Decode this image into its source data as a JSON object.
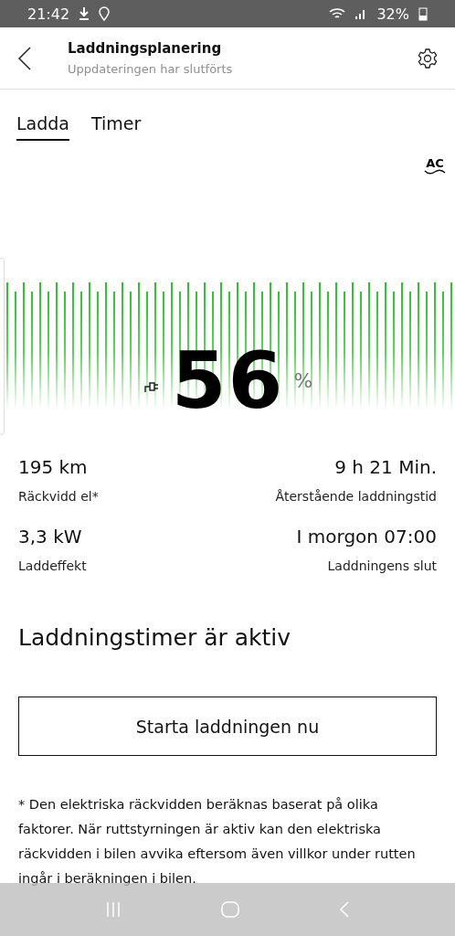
{
  "status_bar": {
    "time": "21:42",
    "battery": "32%"
  },
  "header": {
    "title": "Laddningsplanering",
    "subtitle": "Uppdateringen har slutförts"
  },
  "tabs": [
    {
      "label": "Ladda",
      "selected": true
    },
    {
      "label": "Timer",
      "selected": false
    }
  ],
  "charge": {
    "mode": "AC",
    "value": "56",
    "unit": "%"
  },
  "stats": [
    {
      "value": "195 km",
      "label": "Räckvidd el*"
    },
    {
      "value": "9 h 21 Min.",
      "label": "Återstående laddningstid"
    },
    {
      "value": "3,3 kW",
      "label": "Laddeffekt"
    },
    {
      "value": "I morgon 07:00",
      "label": "Laddningens slut"
    }
  ],
  "timer_status": "Laddningstimer är aktiv",
  "start_button": "Starta laddningen nu",
  "footnote": "* Den elektriska räckvidden beräknas baserat på olika faktorer. När ruttstyrningen är aktiv kan den elektriska räckvidden i bilen avvika eftersom även villkor under rutten ingår i beräkningen i bilen."
}
